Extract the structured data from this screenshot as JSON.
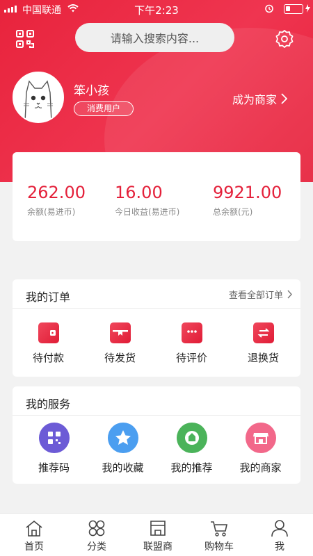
{
  "status_bar": {
    "carrier": "中国联通",
    "time": "下午2:23"
  },
  "header": {
    "search_placeholder": "请输入搜索内容...",
    "username": "笨小孩",
    "user_badge": "消费用户",
    "merchant_link": "成为商家"
  },
  "balance": [
    {
      "value": "262.00",
      "label": "余额(易进币)"
    },
    {
      "value": "16.00",
      "label": "今日收益(易进币)"
    },
    {
      "value": "9921.00",
      "label": "总余额(元)"
    }
  ],
  "orders": {
    "title": "我的订单",
    "view_all": "查看全部订单",
    "items": [
      {
        "label": "待付款",
        "icon": "wallet-icon"
      },
      {
        "label": "待发货",
        "icon": "gift-box-icon"
      },
      {
        "label": "待评价",
        "icon": "chat-bubble-icon"
      },
      {
        "label": "退换货",
        "icon": "exchange-icon"
      }
    ]
  },
  "services": {
    "title": "我的服务",
    "items": [
      {
        "label": "推荐码",
        "icon": "qr-code-icon",
        "color": "#6c5bd6"
      },
      {
        "label": "我的收藏",
        "icon": "star-icon",
        "color": "#4b9ef0"
      },
      {
        "label": "我的推荐",
        "icon": "recommend-icon",
        "color": "#4bb35a"
      },
      {
        "label": "我的商家",
        "icon": "shop-icon",
        "color": "#f2688a"
      }
    ]
  },
  "tabbar": [
    {
      "label": "首页",
      "icon": "home-icon"
    },
    {
      "label": "分类",
      "icon": "category-icon"
    },
    {
      "label": "联盟商",
      "icon": "store-icon"
    },
    {
      "label": "购物车",
      "icon": "cart-icon"
    },
    {
      "label": "我",
      "icon": "person-icon"
    }
  ],
  "colors": {
    "brand_red": "#e8233c",
    "amount_red": "#e4203a",
    "page_bg": "#f2f2f2"
  }
}
